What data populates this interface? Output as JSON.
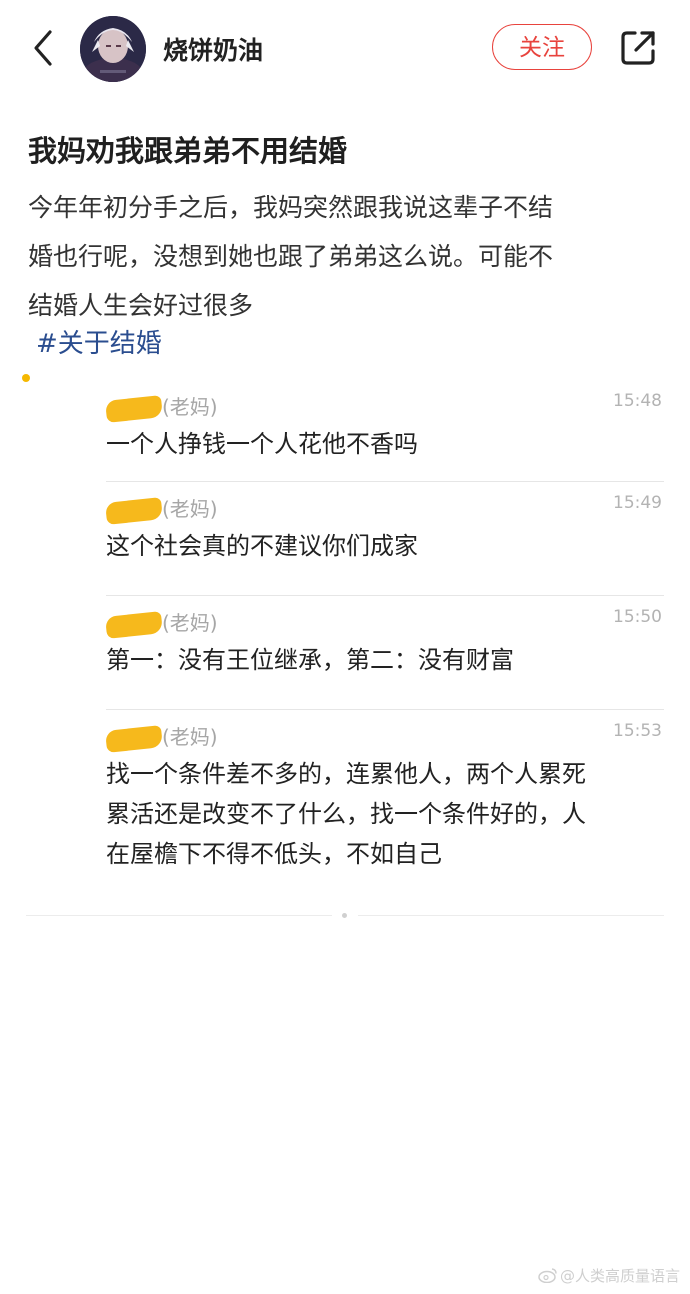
{
  "header": {
    "username": "烧饼奶油",
    "follow_label": "关注",
    "back_icon": "chevron-left-icon",
    "share_icon": "share-icon",
    "avatar_icon": "anime-character-avatar"
  },
  "post": {
    "title": "我妈劝我跟弟弟不用结婚",
    "body_lines": [
      "今年年初分手之后，我妈突然跟我说这辈子不结",
      "婚也行呢，没想到她也跟了弟弟这么说。可能不",
      "结婚人生会好过很多"
    ],
    "hashtag": "#关于结婚"
  },
  "chat": {
    "messages": [
      {
        "sender": "(老妈)",
        "time": "15:48",
        "lines": [
          "一个人挣钱一个人花他不香吗"
        ]
      },
      {
        "sender": "(老妈)",
        "time": "15:49",
        "lines": [
          "这个社会真的不建议你们成家"
        ]
      },
      {
        "sender": "(老妈)",
        "time": "15:50",
        "lines": [
          "第一：没有王位继承，第二：没有财富"
        ]
      },
      {
        "sender": "(老妈)",
        "time": "15:53",
        "lines": [
          "找一个条件差不多的，连累他人，两个人累死",
          "累活还是改变不了什么，找一个条件好的，人",
          "在屋檐下不得不低头，不如自己"
        ]
      }
    ]
  },
  "watermark": {
    "text": "@人类高质量语言",
    "icon": "weibo-icon"
  },
  "colors": {
    "accent": "#e8433d",
    "hashtag": "#2a4d8f",
    "redaction": "#f6b91c"
  }
}
